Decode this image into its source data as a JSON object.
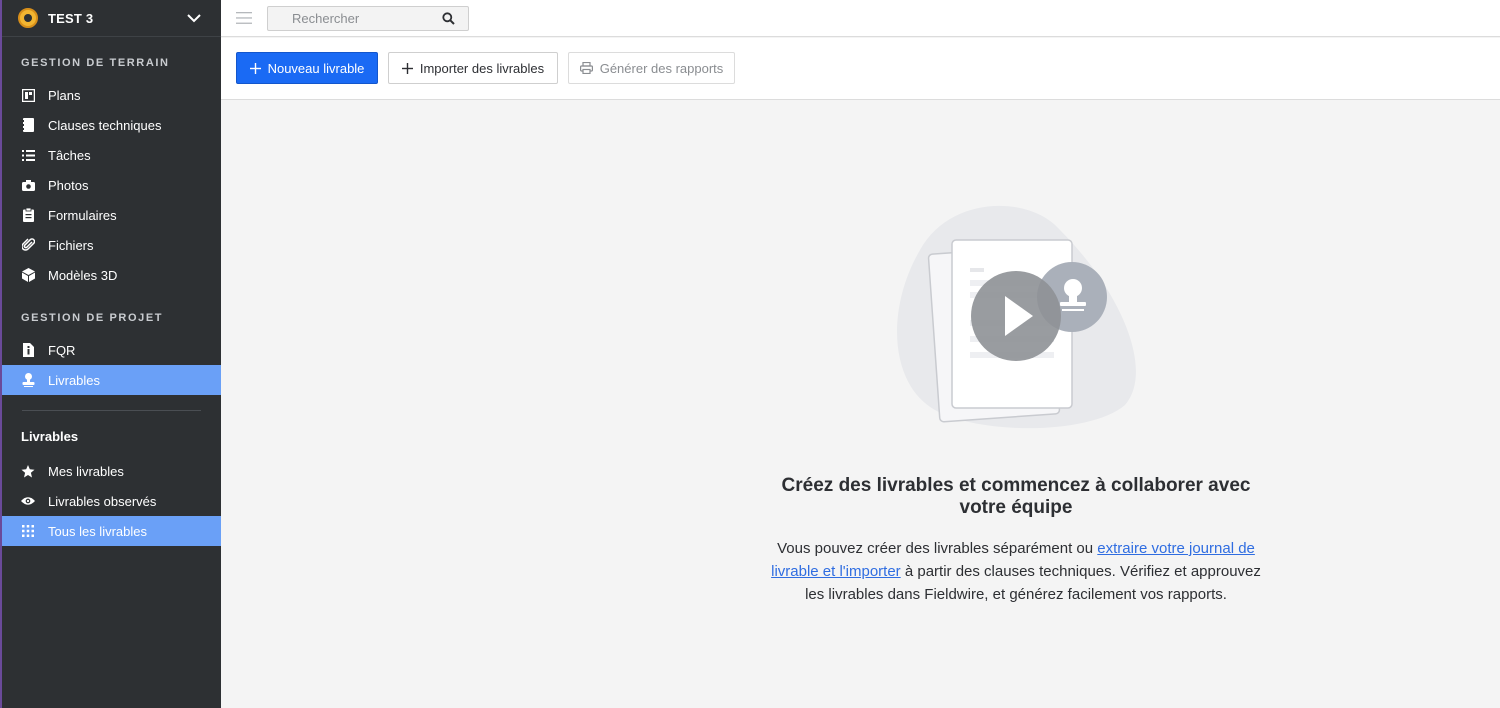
{
  "project": {
    "name": "TEST 3"
  },
  "sidebar": {
    "section_terrain": "GESTION DE TERRAIN",
    "terrain_items": [
      {
        "label": "Plans",
        "icon": "plans-icon"
      },
      {
        "label": "Clauses techniques",
        "icon": "specs-icon"
      },
      {
        "label": "Tâches",
        "icon": "tasks-icon"
      },
      {
        "label": "Photos",
        "icon": "camera-icon"
      },
      {
        "label": "Formulaires",
        "icon": "clipboard-icon"
      },
      {
        "label": "Fichiers",
        "icon": "paperclip-icon"
      },
      {
        "label": "Modèles 3D",
        "icon": "cube-icon"
      }
    ],
    "section_projet": "GESTION DE PROJET",
    "projet_items": [
      {
        "label": "FQR",
        "icon": "info-file-icon"
      },
      {
        "label": "Livrables",
        "icon": "stamp-icon"
      }
    ],
    "sub_title": "Livrables",
    "sub_items": [
      {
        "label": "Mes livrables",
        "icon": "star-icon"
      },
      {
        "label": "Livrables observés",
        "icon": "eye-icon"
      },
      {
        "label": "Tous les livrables",
        "icon": "grid-icon"
      }
    ]
  },
  "topbar": {
    "search_placeholder": "Rechercher"
  },
  "toolbar": {
    "new_label": "Nouveau livrable",
    "import_label": "Importer des livrables",
    "report_label": "Générer des rapports"
  },
  "empty_state": {
    "title": "Créez des livrables et commencez à collaborer avec votre équipe",
    "text_before": "Vous pouvez créer des livrables séparément ou ",
    "link": "extraire votre journal de livrable et l'importer",
    "text_after": " à partir des clauses techniques. Vérifiez et approuvez les livrables dans Fieldwire, et générez facilement vos rapports."
  },
  "colors": {
    "sidebar_bg": "#2d3033",
    "active_item": "#6aa0f7",
    "primary": "#1a6af4",
    "link": "#2f6de1"
  }
}
